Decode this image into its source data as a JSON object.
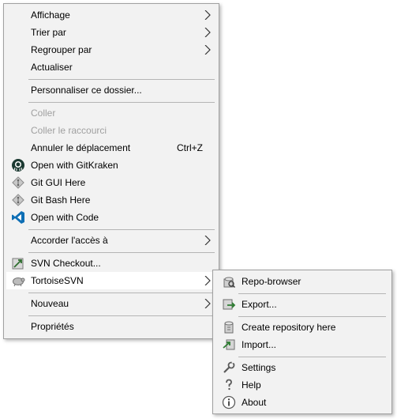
{
  "context_menu": {
    "items": [
      {
        "label": "Affichage"
      },
      {
        "label": "Trier par"
      },
      {
        "label": "Regrouper par"
      },
      {
        "label": "Actualiser"
      },
      {
        "label": "Personnaliser ce dossier..."
      },
      {
        "label": "Coller"
      },
      {
        "label": "Coller le raccourci"
      },
      {
        "label": "Annuler le déplacement",
        "shortcut": "Ctrl+Z"
      },
      {
        "label": "Open with GitKraken",
        "icon": "gitkraken-icon"
      },
      {
        "label": "Git GUI Here",
        "icon": "git-gui-icon"
      },
      {
        "label": "Git Bash Here",
        "icon": "git-bash-icon"
      },
      {
        "label": "Open with Code",
        "icon": "vscode-icon"
      },
      {
        "label": "Accorder l'accès à"
      },
      {
        "label": "SVN Checkout...",
        "icon": "svn-checkout-icon"
      },
      {
        "label": "TortoiseSVN",
        "icon": "tortoisesvn-icon"
      },
      {
        "label": "Nouveau"
      },
      {
        "label": "Propriétés"
      }
    ]
  },
  "tortoisesvn_submenu": {
    "items": [
      {
        "label": "Repo-browser",
        "icon": "repo-browser-icon"
      },
      {
        "label": "Export...",
        "icon": "export-icon"
      },
      {
        "label": "Create repository here",
        "icon": "create-repository-icon"
      },
      {
        "label": "Import...",
        "icon": "import-icon"
      },
      {
        "label": "Settings",
        "icon": "settings-icon"
      },
      {
        "label": "Help",
        "icon": "help-icon"
      },
      {
        "label": "About",
        "icon": "about-icon"
      }
    ]
  },
  "colors": {
    "menu_background": "#f2f2f2",
    "highlight": "#ffffff",
    "disabled_text": "#a0a0a0",
    "separator": "#b5b5b5"
  }
}
